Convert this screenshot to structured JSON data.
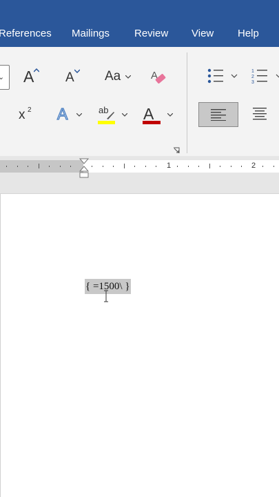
{
  "tabs": [
    {
      "label": "References"
    },
    {
      "label": "Mailings"
    },
    {
      "label": "Review"
    },
    {
      "label": "View"
    },
    {
      "label": "Help"
    }
  ],
  "ribbon": {
    "grow_font_glyph": "A",
    "shrink_font_glyph": "A",
    "change_case_glyph": "Aa",
    "superscript_base": "x",
    "superscript_exp": "2",
    "text_effects_glyph": "A",
    "highlight_glyph": "ab",
    "font_color_glyph": "A",
    "highlight_color": "#ffff00",
    "font_color": "#c00000"
  },
  "ruler": {
    "numbers": [
      "1",
      "2"
    ]
  },
  "document": {
    "field_code": "{ =1500\\ }"
  },
  "colors": {
    "tab_bar": "#2b579a",
    "ribbon_bg": "#f3f3f3",
    "field_shading": "#c8c8c8"
  }
}
